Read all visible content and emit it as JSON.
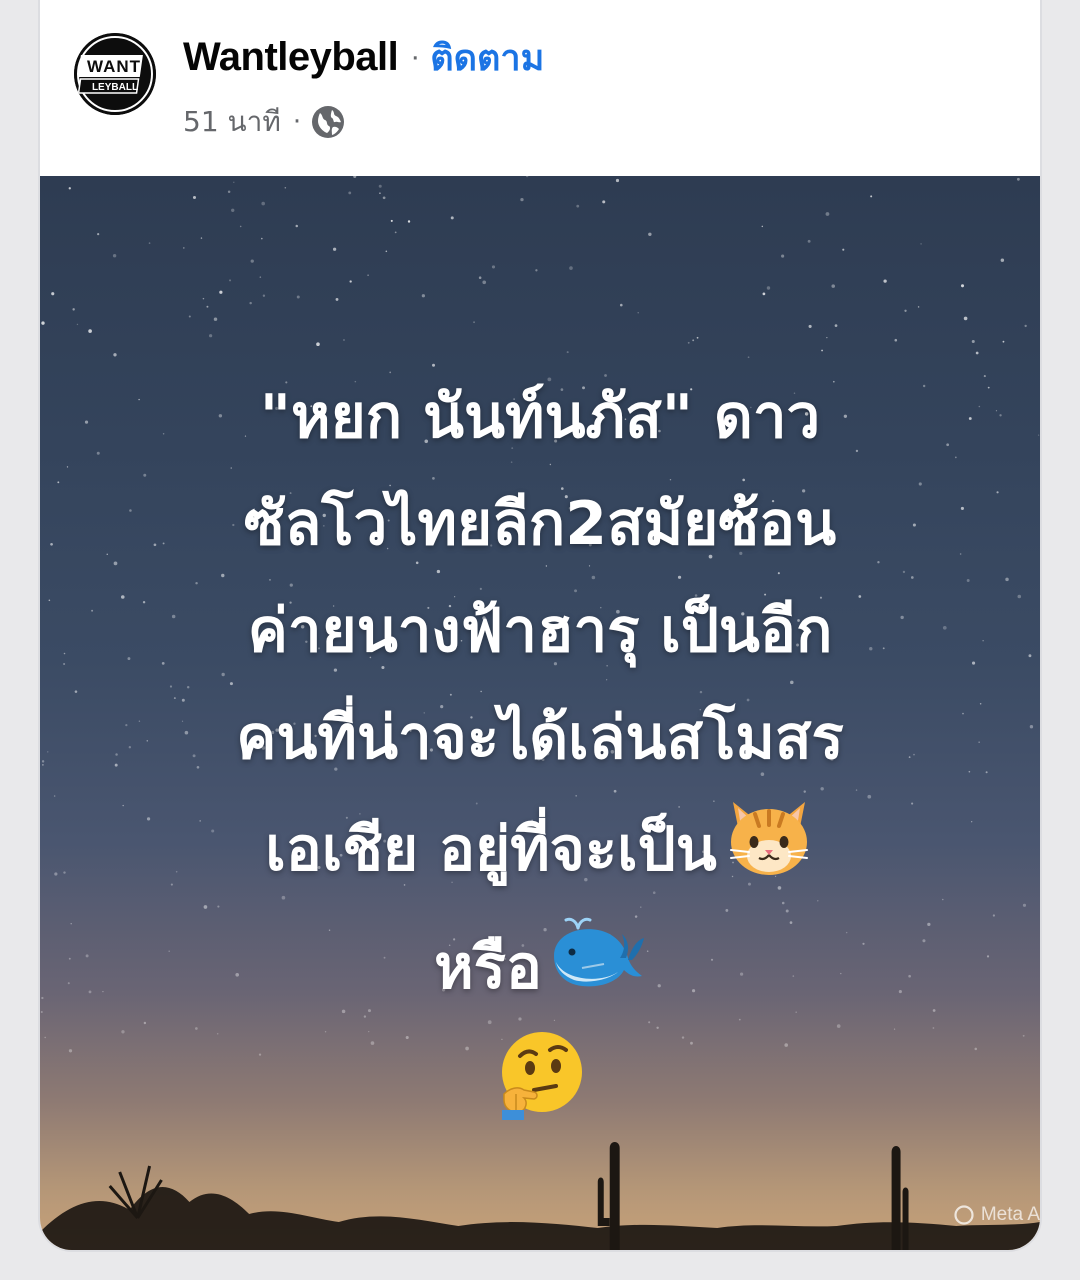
{
  "post": {
    "author": {
      "name": "Wantleyball",
      "avatar_text": "WANT LEYBALL",
      "separator": "·",
      "follow_label": "ติดตาม"
    },
    "meta": {
      "time": "51 นาที",
      "separator": "·",
      "privacy_icon": "globe-icon"
    },
    "image": {
      "text_lines": [
        "\"หยก นันท์นภัส\" ดาว",
        "ซัลโวไทยลีก2สมัยซ้อน",
        "ค่ายนางฟ้าฮารุ เป็นอีก",
        "คนที่น่าจะได้เล่นสโมสร",
        "เอเชีย อยู่ที่จะเป็น",
        "หรือ"
      ],
      "emojis": {
        "cat": "🐱",
        "whale": "🐋",
        "thinking": "🤔"
      },
      "watermark": "Meta A",
      "watermark_icon": "meta-ai-circle-icon"
    }
  },
  "colors": {
    "author": "#050505",
    "follow": "#1b74e4",
    "meta": "#65676b",
    "sky_top": "#2e3c52",
    "sky_bottom": "#c9a37a"
  }
}
